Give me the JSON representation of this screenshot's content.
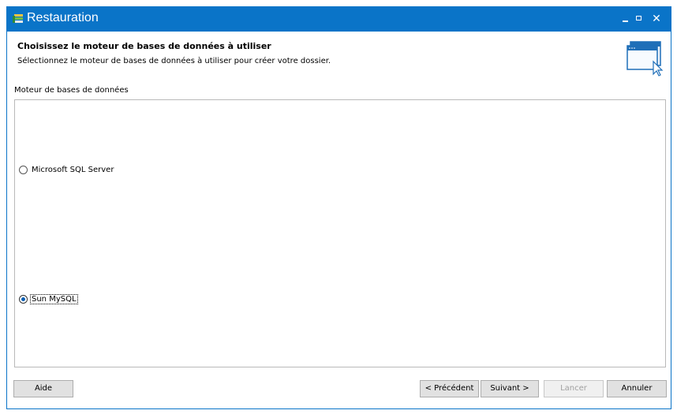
{
  "window": {
    "title": "Restauration"
  },
  "header": {
    "heading": "Choisissez le moteur de bases de données à utiliser",
    "subheading": "Sélectionnez le moteur de bases de données à utiliser pour créer votre dossier."
  },
  "engine_group": {
    "label": "Moteur de bases de données",
    "options": [
      {
        "label": "Microsoft SQL Server",
        "selected": false
      },
      {
        "label": "Sun MySQL",
        "selected": true
      }
    ]
  },
  "buttons": {
    "help": "Aide",
    "previous": "< Précédent",
    "next": "Suivant >",
    "launch": "Lancer",
    "cancel": "Annuler"
  },
  "colors": {
    "accent": "#0a74c8"
  }
}
